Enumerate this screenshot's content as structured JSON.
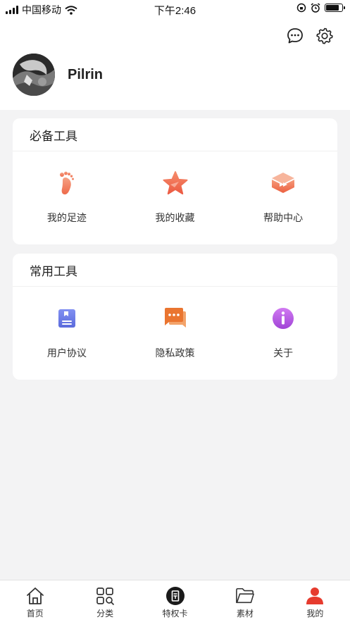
{
  "status_bar": {
    "carrier": "中国移动",
    "time": "下午2:46",
    "battery_level": 0.85
  },
  "profile": {
    "username": "Pilrin",
    "header_icons": [
      "chat-icon",
      "settings-icon"
    ]
  },
  "essential_tools": {
    "title": "必备工具",
    "items": [
      {
        "label": "我的足迹",
        "icon": "footprint-icon"
      },
      {
        "label": "我的收藏",
        "icon": "star-icon"
      },
      {
        "label": "帮助中心",
        "icon": "help-center-icon"
      }
    ]
  },
  "common_tools": {
    "title": "常用工具",
    "items": [
      {
        "label": "用户协议",
        "icon": "agreement-icon"
      },
      {
        "label": "隐私政策",
        "icon": "privacy-icon"
      },
      {
        "label": "关于",
        "icon": "info-icon"
      }
    ]
  },
  "tabbar": {
    "active_index": 4,
    "items": [
      {
        "label": "首页",
        "icon": "home-icon"
      },
      {
        "label": "分类",
        "icon": "category-icon"
      },
      {
        "label": "特权卡",
        "icon": "privilege-card-icon"
      },
      {
        "label": "素材",
        "icon": "folder-icon"
      },
      {
        "label": "我的",
        "icon": "user-icon"
      }
    ]
  },
  "colors": {
    "accent_red": "#e63b2e",
    "footprint": "#f07a5c",
    "star": "#f26a4f",
    "help": "#f0714d",
    "agreement": "#6f7ee8",
    "privacy": "#ec7b2f",
    "info": "#b255e0"
  }
}
